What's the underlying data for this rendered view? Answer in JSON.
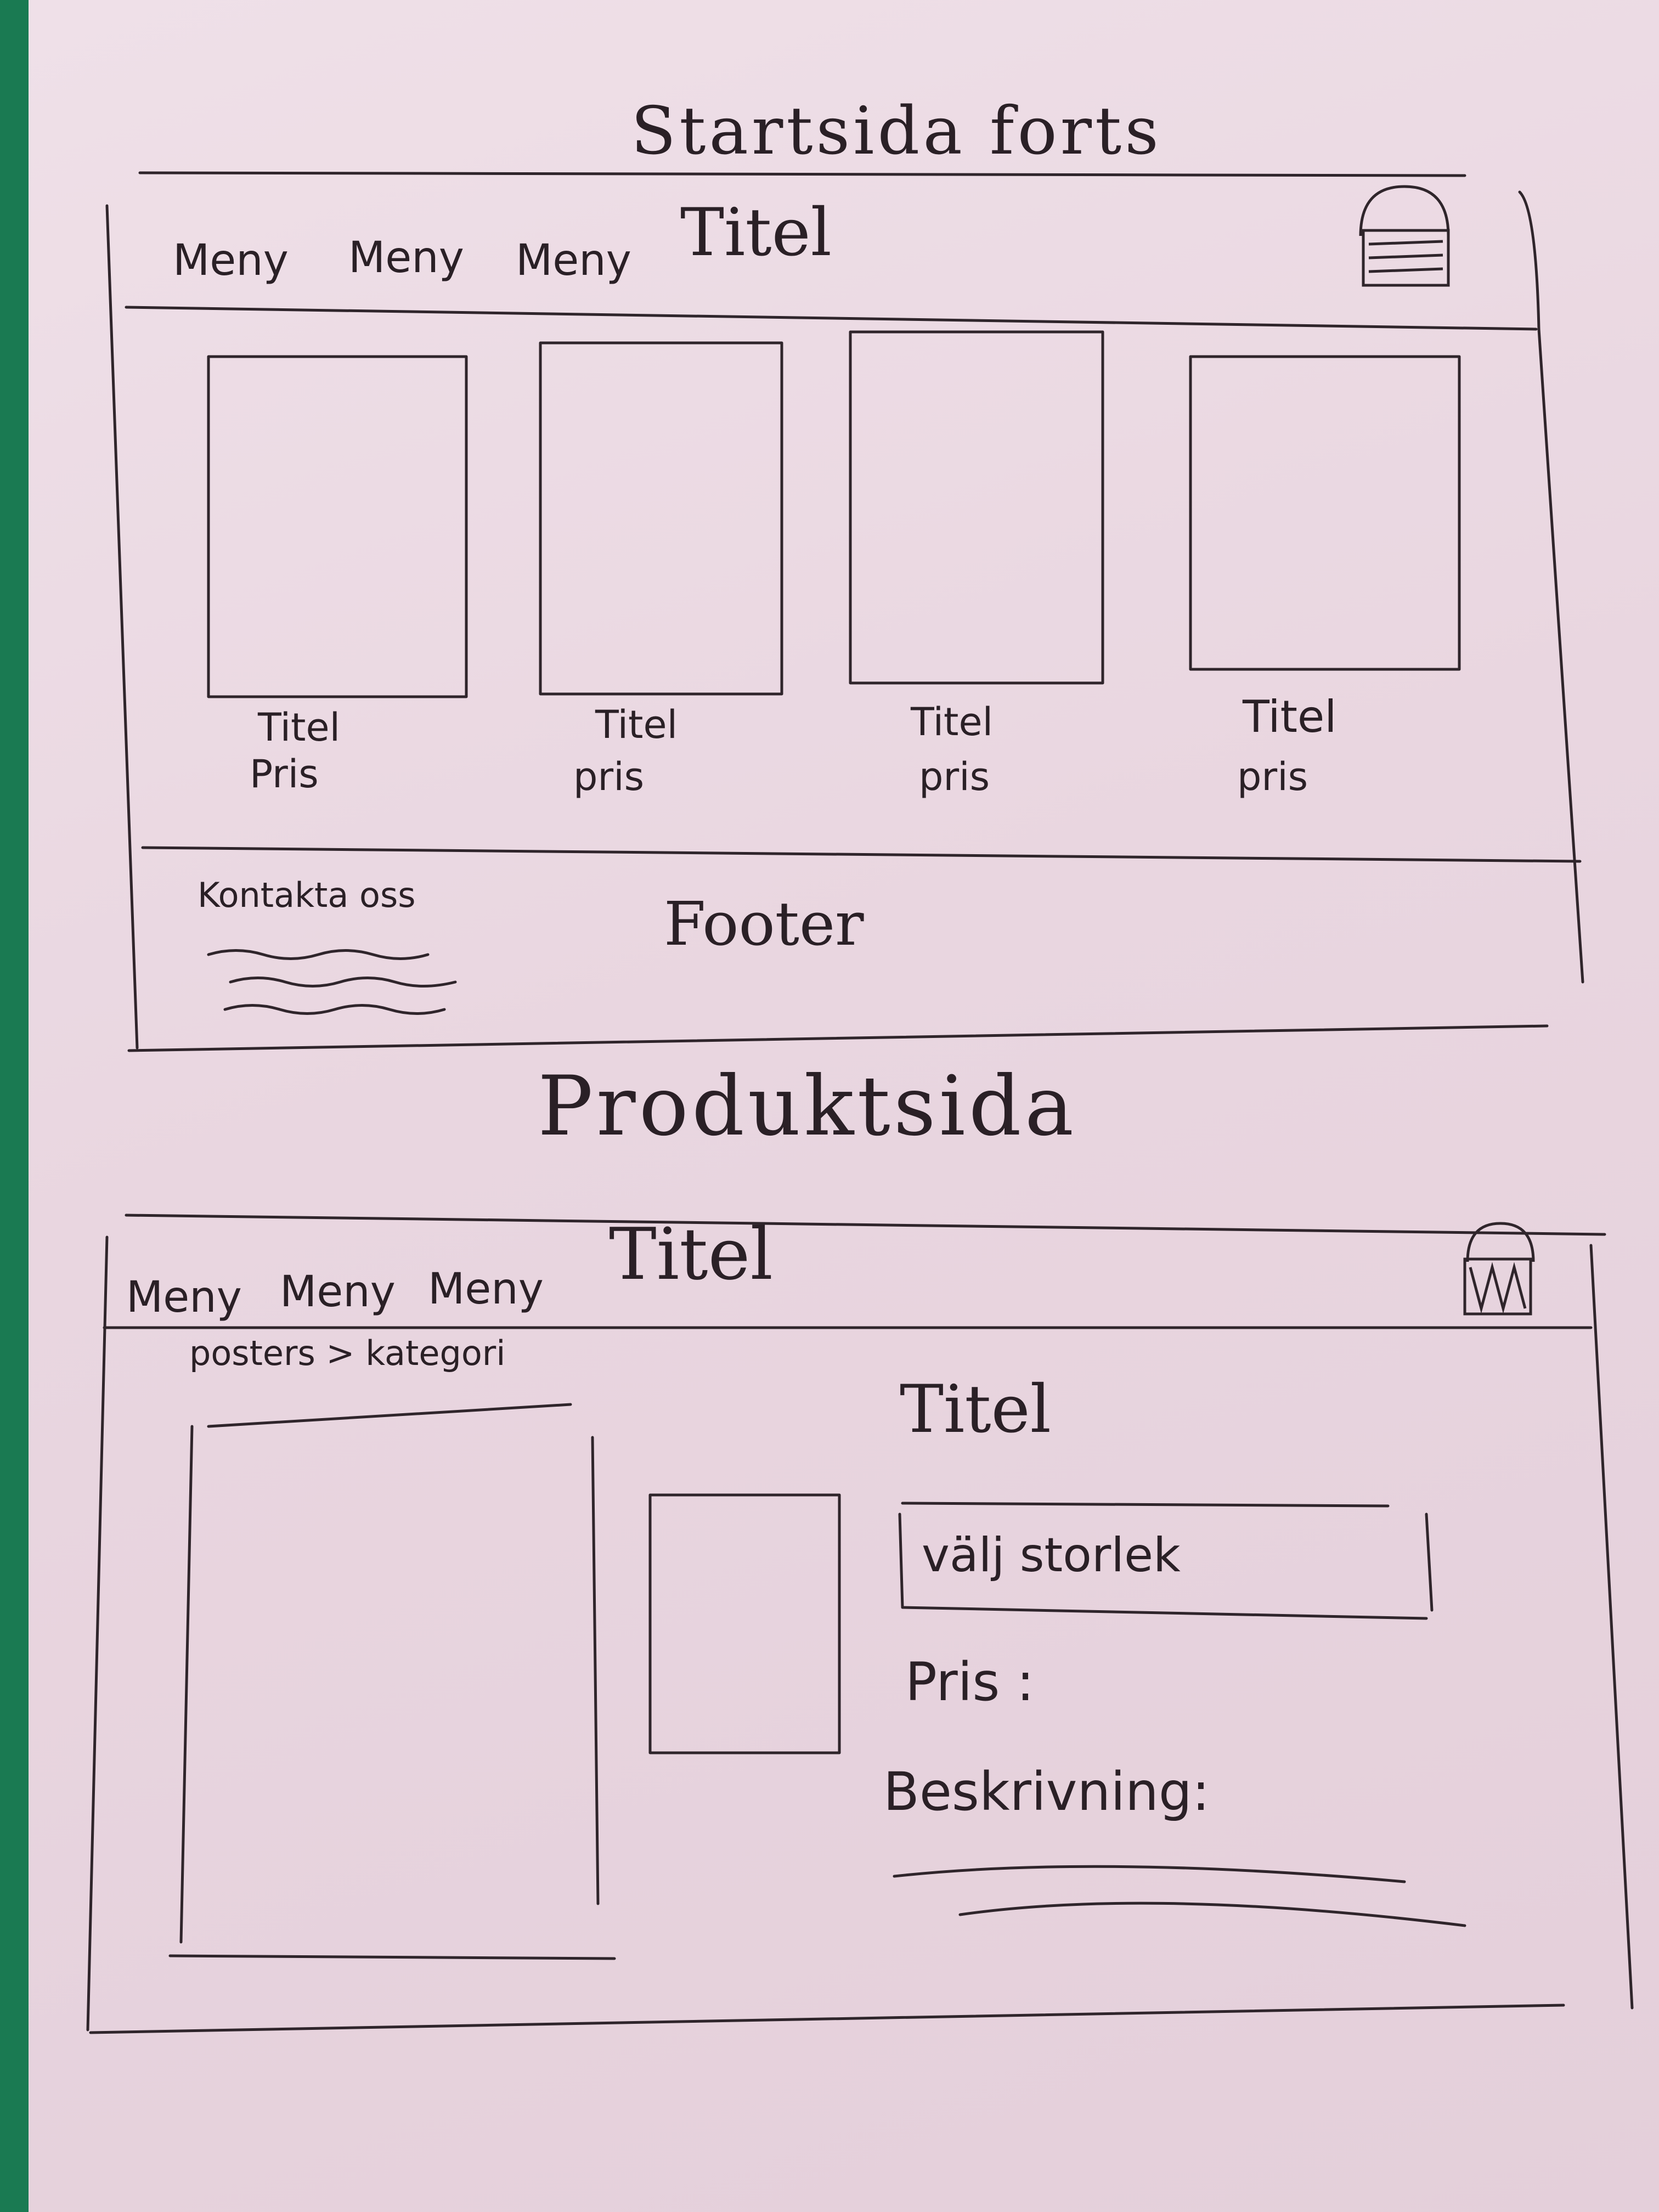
{
  "sketch1": {
    "heading": "Startsida forts",
    "header": {
      "menu_items": [
        "Meny",
        "Meny",
        "Meny"
      ],
      "title": "Titel",
      "basket_icon": "basket-icon"
    },
    "products": [
      {
        "title": "Titel",
        "price": "Pris"
      },
      {
        "title": "Titel",
        "price": "pris"
      },
      {
        "title": "Titel",
        "price": "pris"
      },
      {
        "title": "Titel",
        "price": "pris"
      }
    ],
    "footer": {
      "contact": "Kontakta oss",
      "label": "Footer"
    }
  },
  "sketch2": {
    "heading": "Produktsida",
    "header": {
      "menu_items": [
        "Meny",
        "Meny",
        "Meny"
      ],
      "title": "Titel",
      "basket_icon": "basket-icon"
    },
    "breadcrumb": "posters > kategori",
    "product": {
      "title": "Titel",
      "size_select": "välj storlek",
      "price_label": "Pris :",
      "description_label": "Beskrivning:"
    }
  },
  "colors": {
    "paper": "#ecdbe4",
    "pencil": "#2a2026",
    "background": "#1a7a52"
  }
}
